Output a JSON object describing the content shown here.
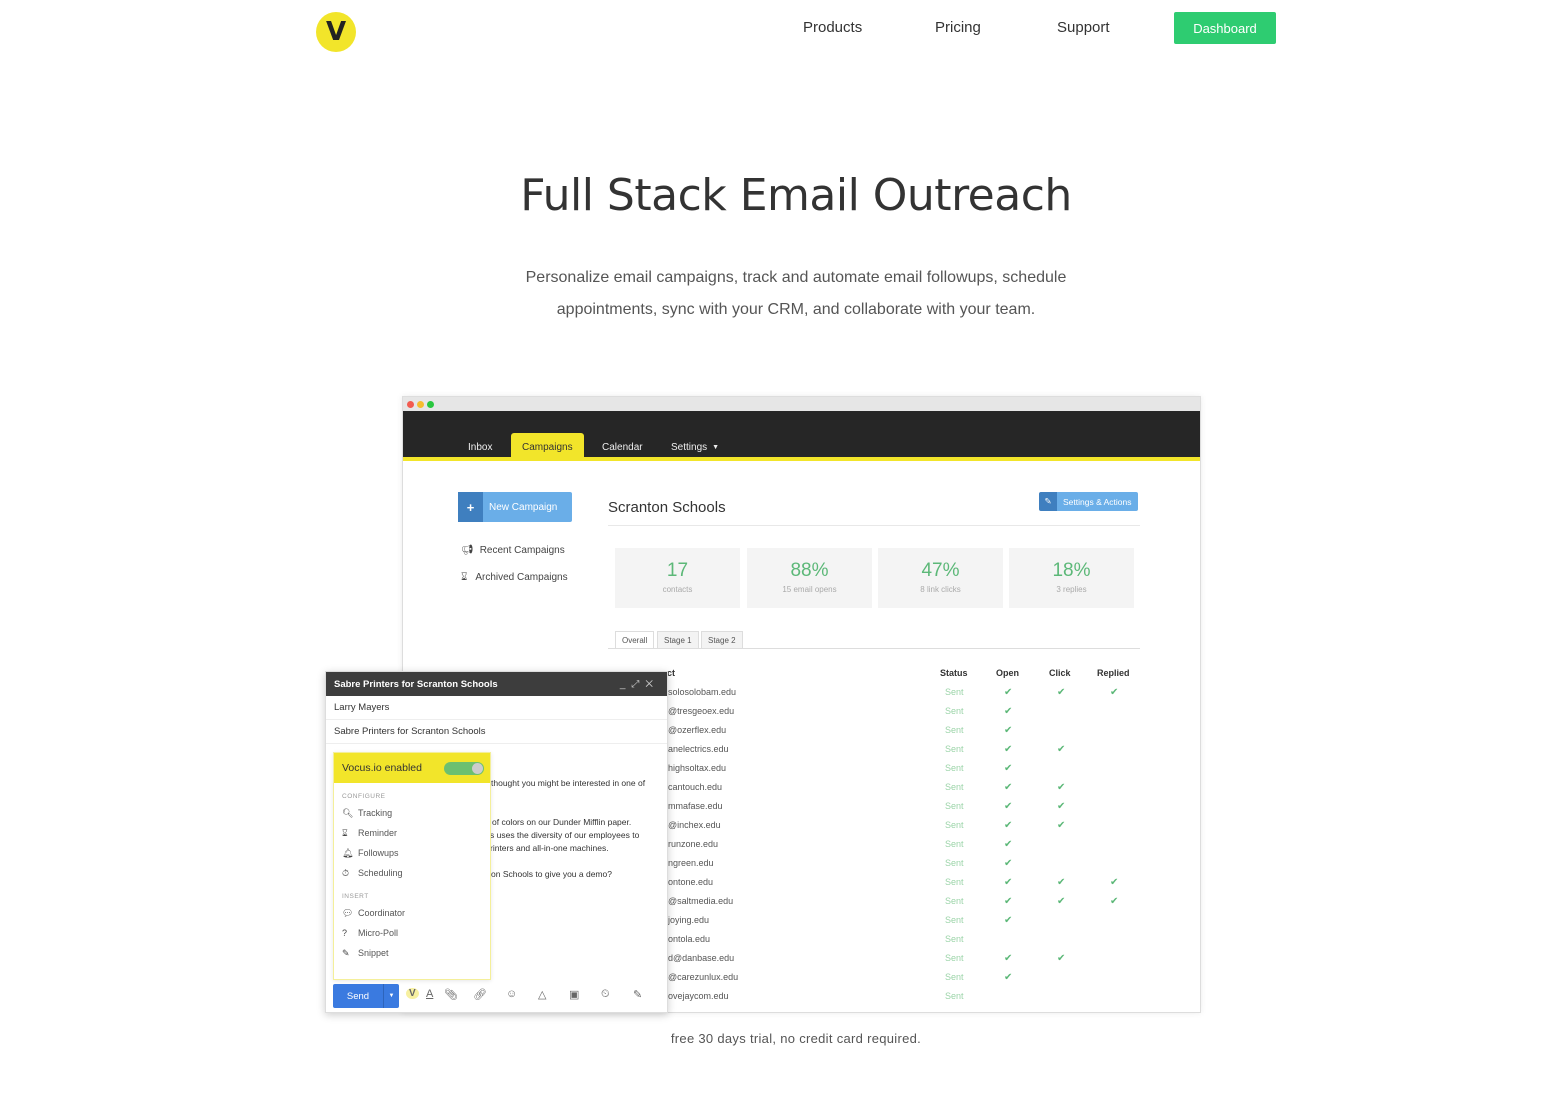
{
  "header": {
    "logo": "V",
    "nav": [
      "Products",
      "Pricing",
      "Support"
    ],
    "dashboard": "Dashboard"
  },
  "hero": {
    "title": "Full Stack Email Outreach",
    "sub1": "Personalize email campaigns, track and automate email followups, schedule",
    "sub2": "appointments, sync with your CRM, and collaborate with your team."
  },
  "app": {
    "tabs": [
      "Inbox",
      "Campaigns",
      "Calendar",
      "Settings"
    ],
    "new_campaign": "New Campaign",
    "side": [
      "Recent Campaigns",
      "Archived Campaigns"
    ],
    "campaign_title": "Scranton Schools",
    "settings_actions": "Settings & Actions",
    "stats": [
      {
        "v": "17",
        "l": "contacts"
      },
      {
        "v": "88%",
        "l": "15 email opens"
      },
      {
        "v": "47%",
        "l": "8 link clicks"
      },
      {
        "v": "18%",
        "l": "3 replies"
      }
    ],
    "stage_tabs": [
      "Overall",
      "Stage 1",
      "Stage 2"
    ],
    "columns": [
      "ct",
      "Status",
      "Open",
      "Click",
      "Replied"
    ],
    "rows": [
      {
        "email": "solosolobam.edu",
        "status": "Sent",
        "open": true,
        "click": true,
        "replied": true
      },
      {
        "email": "@tresgeoex.edu",
        "status": "Sent",
        "open": true,
        "click": false,
        "replied": false
      },
      {
        "email": "@ozerflex.edu",
        "status": "Sent",
        "open": true,
        "click": false,
        "replied": false
      },
      {
        "email": "anelectrics.edu",
        "status": "Sent",
        "open": true,
        "click": true,
        "replied": false
      },
      {
        "email": "highsoltax.edu",
        "status": "Sent",
        "open": true,
        "click": false,
        "replied": false
      },
      {
        "email": "cantouch.edu",
        "status": "Sent",
        "open": true,
        "click": true,
        "replied": false
      },
      {
        "email": "mmafase.edu",
        "status": "Sent",
        "open": true,
        "click": true,
        "replied": false
      },
      {
        "email": "@inchex.edu",
        "status": "Sent",
        "open": true,
        "click": true,
        "replied": false
      },
      {
        "email": "runzone.edu",
        "status": "Sent",
        "open": true,
        "click": false,
        "replied": false
      },
      {
        "email": "ngreen.edu",
        "status": "Sent",
        "open": true,
        "click": false,
        "replied": false
      },
      {
        "email": "ontone.edu",
        "status": "Sent",
        "open": true,
        "click": true,
        "replied": true
      },
      {
        "email": "@saltmedia.edu",
        "status": "Sent",
        "open": true,
        "click": true,
        "replied": true
      },
      {
        "email": "joying.edu",
        "status": "Sent",
        "open": true,
        "click": false,
        "replied": false
      },
      {
        "email": "ontola.edu",
        "status": "Sent",
        "open": false,
        "click": false,
        "replied": false
      },
      {
        "email": "d@danbase.edu",
        "status": "Sent",
        "open": true,
        "click": true,
        "replied": false
      },
      {
        "email": "@carezunlux.edu",
        "status": "Sent",
        "open": true,
        "click": false,
        "replied": false
      },
      {
        "email": "ovejaycom.edu",
        "status": "Sent",
        "open": false,
        "click": false,
        "replied": false
      }
    ]
  },
  "compose": {
    "title": "Sabre Printers for Scranton Schools",
    "to": "Larry Mayers",
    "subject": "Sabre Printers for Scranton Schools",
    "enabled": "Vocus.io enabled",
    "configure": "CONFIGURE",
    "config_items": [
      "Tracking",
      "Reminder",
      "Followups",
      "Scheduling"
    ],
    "insert": "INSERT",
    "insert_items": [
      "Coordinator",
      "Micro-Poll",
      "Snippet"
    ],
    "body": [
      "thought you might be interested in one of",
      "of colors on our Dunder Mifflin paper.",
      "s uses the diversity of our employees to",
      "rinters and all-in-one machines.",
      "on Schools to give you a demo?"
    ],
    "send": "Send"
  },
  "footer": "free 30 days trial, no credit card required.",
  "colors": {
    "brand_yellow": "#f2e52a",
    "green": "#2ecc71",
    "blue": "#3a7ae0"
  }
}
